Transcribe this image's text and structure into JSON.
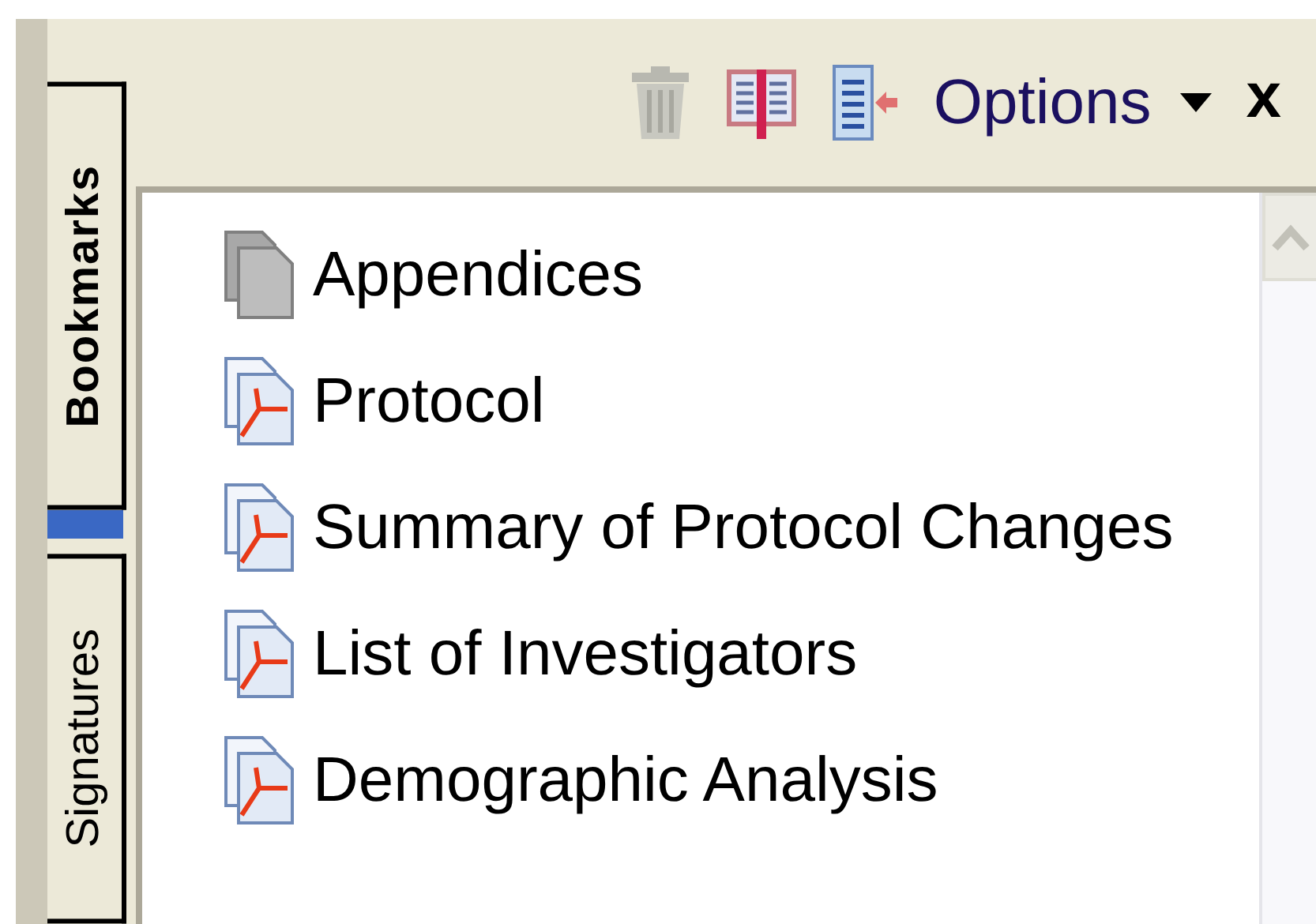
{
  "side_tabs": [
    {
      "label": "Bookmarks",
      "selected": true
    },
    {
      "label": "Signatures",
      "selected": false
    }
  ],
  "toolbar": {
    "delete_disabled": true,
    "options_label": "Options",
    "close_label": "x"
  },
  "bookmarks": [
    {
      "kind": "plain",
      "label": "Appendices"
    },
    {
      "kind": "pdf",
      "label": "Protocol"
    },
    {
      "kind": "pdf",
      "label": "Summary of Protocol Changes"
    },
    {
      "kind": "pdf",
      "label": "List of Investigators"
    },
    {
      "kind": "pdf",
      "label": "Demographic Analysis"
    }
  ]
}
